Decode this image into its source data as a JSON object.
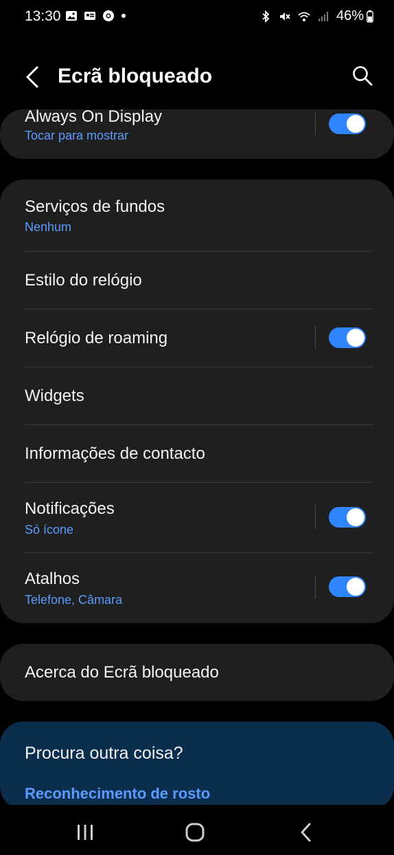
{
  "status_bar": {
    "time": "13:30",
    "battery": "46%"
  },
  "header": {
    "title": "Ecrã bloqueado"
  },
  "always_on": {
    "title": "Always On Display",
    "subtitle": "Tocar para mostrar",
    "toggle_on": true
  },
  "lock_settings": {
    "items": [
      {
        "title": "Serviços de fundos",
        "subtitle": "Nenhum"
      },
      {
        "title": "Estilo do relógio"
      },
      {
        "title": "Relógio de roaming",
        "toggle_on": true
      },
      {
        "title": "Widgets"
      },
      {
        "title": "Informações de contacto"
      },
      {
        "title": "Notificações",
        "subtitle": "Só ícone",
        "toggle_on": true
      },
      {
        "title": "Atalhos",
        "subtitle": "Telefone, Câmara",
        "toggle_on": true
      }
    ]
  },
  "about": {
    "title": "Acerca do Ecrã bloqueado"
  },
  "looking_for": {
    "title": "Procura outra coisa?",
    "link": "Reconhecimento de rosto"
  },
  "colors": {
    "accent": "#2f86ff",
    "link": "#5b9bff",
    "card": "#1f1f1f",
    "background": "#000000",
    "suggestion_card": "#0b2e4e"
  }
}
